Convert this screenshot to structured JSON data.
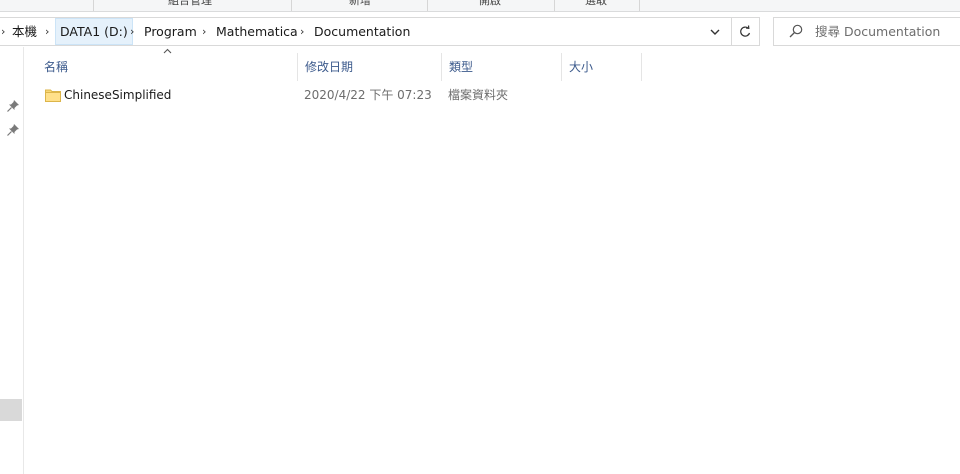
{
  "ribbon": {
    "groups": [
      "組合管理",
      "新增",
      "開啟",
      "選取"
    ]
  },
  "address": {
    "crumbs": [
      "本機",
      "DATA1 (D:)",
      "Program",
      "Mathematica",
      "Documentation"
    ]
  },
  "search": {
    "placeholder": "搜尋 Documentation"
  },
  "columns": {
    "name": "名稱",
    "modified": "修改日期",
    "type": "類型",
    "size": "大小"
  },
  "files": [
    {
      "name": "ChineseSimplified",
      "modified": "2020/4/22 下午 07:23",
      "type": "檔案資料夾",
      "size": ""
    }
  ]
}
